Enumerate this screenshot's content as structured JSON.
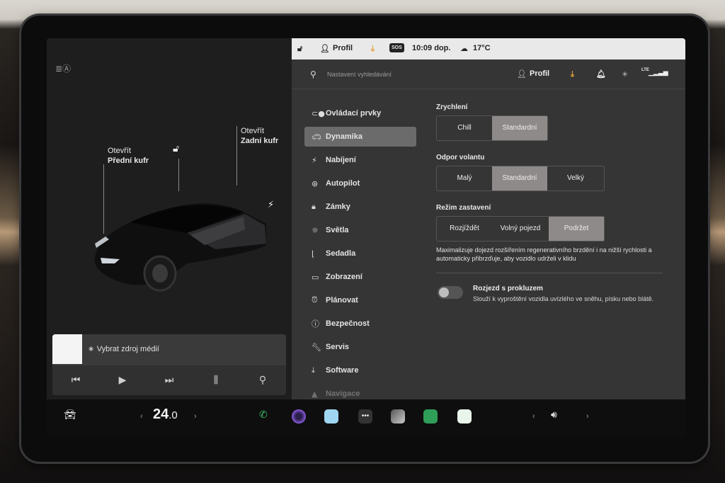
{
  "status_bar": {
    "profile": "Profil",
    "sos": "SOS",
    "time": "10:09 dop.",
    "temperature": "17°C"
  },
  "car_panel": {
    "frunk_line1": "Otevřít",
    "frunk_line2": "Přední kufr",
    "trunk_line1": "Otevřít",
    "trunk_line2": "Zadní kufr"
  },
  "media": {
    "source_label": "Vybrat zdroj médií"
  },
  "search": {
    "placeholder": "Nastavení vyhledávání",
    "profile": "Profil",
    "lte": "LTE"
  },
  "nav": [
    {
      "label": "Ovládací prvky",
      "icon": "toggle-icon"
    },
    {
      "label": "Dynamika",
      "icon": "car-icon"
    },
    {
      "label": "Nabíjení",
      "icon": "bolt-icon"
    },
    {
      "label": "Autopilot",
      "icon": "steering-wheel-icon"
    },
    {
      "label": "Zámky",
      "icon": "lock-icon"
    },
    {
      "label": "Světla",
      "icon": "sun-icon"
    },
    {
      "label": "Sedadla",
      "icon": "seat-icon"
    },
    {
      "label": "Zobrazení",
      "icon": "display-icon"
    },
    {
      "label": "Plánovat",
      "icon": "clock-icon"
    },
    {
      "label": "Bezpečnost",
      "icon": "info-icon"
    },
    {
      "label": "Servis",
      "icon": "wrench-icon"
    },
    {
      "label": "Software",
      "icon": "download-icon"
    },
    {
      "label": "Navigace",
      "icon": "navigation-icon"
    }
  ],
  "dynamics": {
    "acceleration": {
      "title": "Zrychlení",
      "options": [
        "Chill",
        "Standardní"
      ],
      "selected": "Standardní"
    },
    "steering": {
      "title": "Odpor volantu",
      "options": [
        "Malý",
        "Standardní",
        "Velký"
      ],
      "selected": "Standardní"
    },
    "stopping": {
      "title": "Režim zastavení",
      "options": [
        "Rozjíždět",
        "Volný pojezd",
        "Podržet"
      ],
      "selected": "Podržet",
      "description": "Maximalizuje dojezd rozšířením regenerativního brzdění i na nižší rychlosti a automaticky přibrzďuje, aby vozidlo udrželi v klidu"
    },
    "slip_start": {
      "title": "Rozjezd s prokluzem",
      "description": "Slouží k vyproštění vozidla uvízlého ve sněhu, písku nebo blátě.",
      "enabled": false
    }
  },
  "dock": {
    "temp_int": "24",
    "temp_dec": ".0"
  },
  "colors": {
    "accent_orange": "#e8a23a",
    "selected_segment": "#8e8a89",
    "panel_bg": "#353535"
  }
}
